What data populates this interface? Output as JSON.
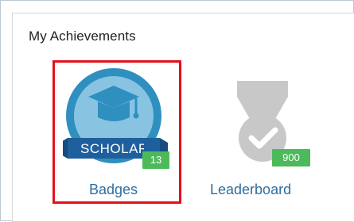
{
  "section": {
    "title": "My Achievements"
  },
  "items": [
    {
      "label": "Badges",
      "count": "13",
      "ribbon_text": "SCHOLAR",
      "icon": "graduation-cap-badge-icon",
      "selected": true
    },
    {
      "label": "Leaderboard",
      "count": "900",
      "icon": "medal-check-icon",
      "selected": false
    }
  ],
  "colors": {
    "badge_outer": "#2f8fbf",
    "badge_inner": "#88c4e2",
    "ribbon": "#1e5f9d",
    "count_bg": "#4cba5a",
    "medal_gray": "#c8c8c8",
    "selection_border": "#e3101c",
    "link": "#2e6e9e"
  }
}
